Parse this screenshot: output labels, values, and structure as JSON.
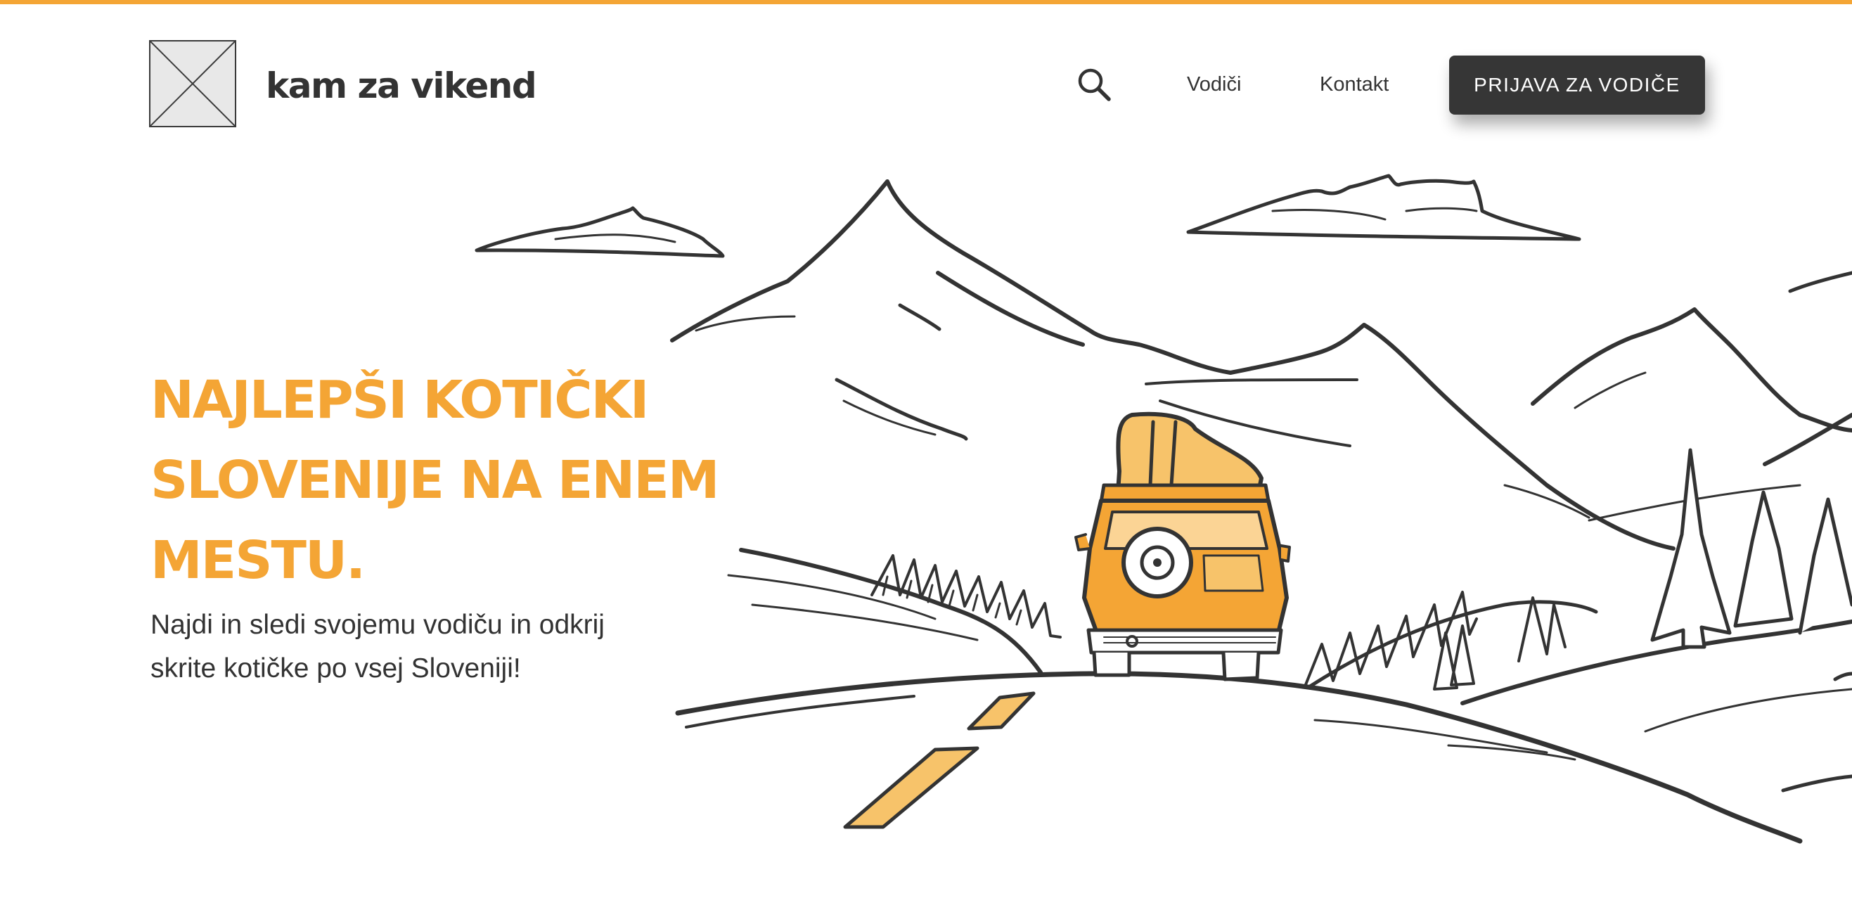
{
  "header": {
    "brand_name": "kam za vikend",
    "nav": {
      "guides_label": "Vodiči",
      "contact_label": "Kontakt"
    },
    "cta_label": "PRIJAVA ZA VODIČE"
  },
  "hero": {
    "title_lines": [
      "NAJLEPŠI KOTIČKI",
      "SLOVENIJE NA ENEM",
      "MESTU."
    ],
    "subtitle_lines": [
      "Najdi in sledi svojemu vodiču in odkrij",
      "skrite kotičke po vsej Sloveniji!"
    ]
  },
  "icons": {
    "logo": "image-placeholder-icon",
    "search": "search-icon"
  },
  "colors": {
    "accent": "#f4a535",
    "text_dark": "#333333",
    "button_bg": "#363636",
    "line_art": "#333333"
  }
}
